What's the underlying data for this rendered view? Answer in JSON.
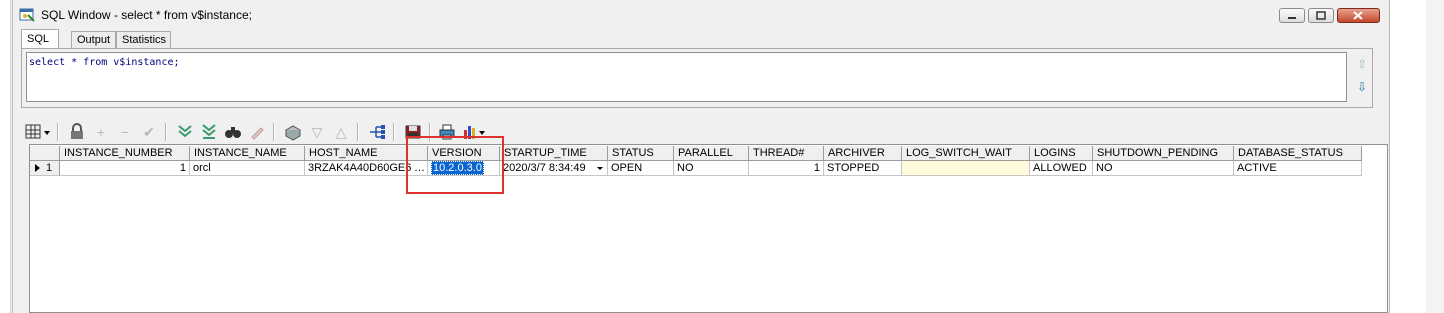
{
  "window": {
    "title": "SQL Window - select * from v$instance;",
    "icon": "sql-window-icon"
  },
  "tabs": [
    {
      "label": "SQL",
      "active": true
    },
    {
      "label": "Output",
      "active": false
    },
    {
      "label": "Statistics",
      "active": false
    }
  ],
  "editor": {
    "sql": "select * from v$instance;"
  },
  "toolbar": {
    "icons": [
      "grid-view-icon",
      "lock-icon",
      "add-record-icon",
      "delete-record-icon",
      "post-changes-icon",
      "fetch-next-icon",
      "fetch-last-icon",
      "find-icon",
      "clear-icon",
      "export-icon",
      "filter-icon",
      "sort-icon",
      "query-by-example-icon",
      "save-icon",
      "print-icon",
      "chart-icon"
    ]
  },
  "grid": {
    "columns": [
      "",
      "INSTANCE_NUMBER",
      "INSTANCE_NAME",
      "HOST_NAME",
      "VERSION",
      "STARTUP_TIME",
      "STATUS",
      "PARALLEL",
      "THREAD#",
      "ARCHIVER",
      "LOG_SWITCH_WAIT",
      "LOGINS",
      "SHUTDOWN_PENDING",
      "DATABASE_STATUS"
    ],
    "rows": [
      {
        "row_number": "1",
        "instance_number": "1",
        "instance_name": "orcl",
        "host_name": "3RZAK4A40D60GE6",
        "version": "10.2.0.3.0",
        "startup_time": "2020/3/7 8:34:49",
        "status": "OPEN",
        "parallel": "NO",
        "thread": "1",
        "archiver": "STOPPED",
        "log_switch_wait": "",
        "logins": "ALLOWED",
        "shutdown_pending": "NO",
        "database_status": "ACTIVE"
      }
    ]
  },
  "colors": {
    "selection": "#0a64d2",
    "highlight_box": "#e03131",
    "editor_text": "#000080"
  }
}
